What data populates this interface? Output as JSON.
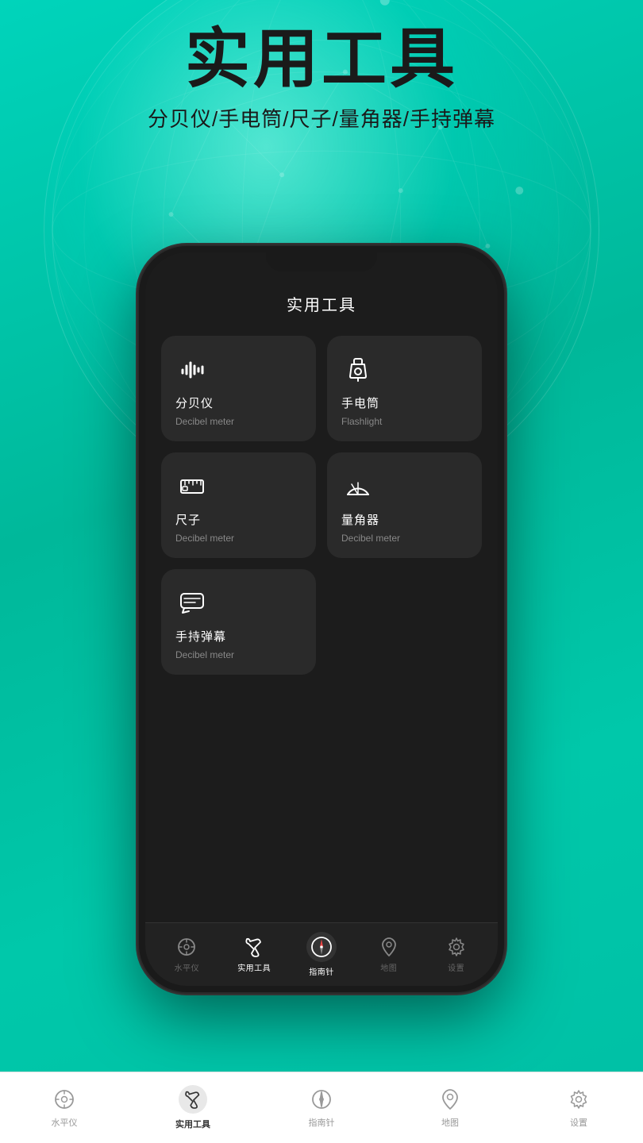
{
  "background": {
    "color_top": "#00d4bb",
    "color_bottom": "#00bfa5"
  },
  "header": {
    "main_title": "实用工具",
    "sub_title": "分贝仪/手电筒/尺子/量角器/手持弹幕"
  },
  "phone": {
    "screen_title": "实用工具",
    "tools": [
      {
        "id": "decibel",
        "name_cn": "分贝仪",
        "name_en": "Decibel meter",
        "icon": "decibel"
      },
      {
        "id": "flashlight",
        "name_cn": "手电筒",
        "name_en": "Flashlight",
        "icon": "flashlight"
      },
      {
        "id": "ruler",
        "name_cn": "尺子",
        "name_en": "Decibel meter",
        "icon": "ruler"
      },
      {
        "id": "protractor",
        "name_cn": "量角器",
        "name_en": "Decibel meter",
        "icon": "protractor"
      },
      {
        "id": "danmu",
        "name_cn": "手持弹幕",
        "name_en": "Decibel meter",
        "icon": "danmu"
      }
    ],
    "nav": [
      {
        "id": "level",
        "label": "水平仪",
        "active": false
      },
      {
        "id": "tools",
        "label": "实用工具",
        "active": true
      },
      {
        "id": "compass",
        "label": "指南针",
        "active": false
      },
      {
        "id": "map",
        "label": "地图",
        "active": false
      },
      {
        "id": "settings",
        "label": "设置",
        "active": false
      }
    ]
  },
  "bottom_bar": [
    {
      "id": "level",
      "label": "水平仪",
      "active": false
    },
    {
      "id": "tools",
      "label": "实用工具",
      "active": true
    },
    {
      "id": "compass",
      "label": "指南针",
      "active": false
    },
    {
      "id": "map",
      "label": "地图",
      "active": false
    },
    {
      "id": "settings",
      "label": "设置",
      "active": false
    }
  ]
}
